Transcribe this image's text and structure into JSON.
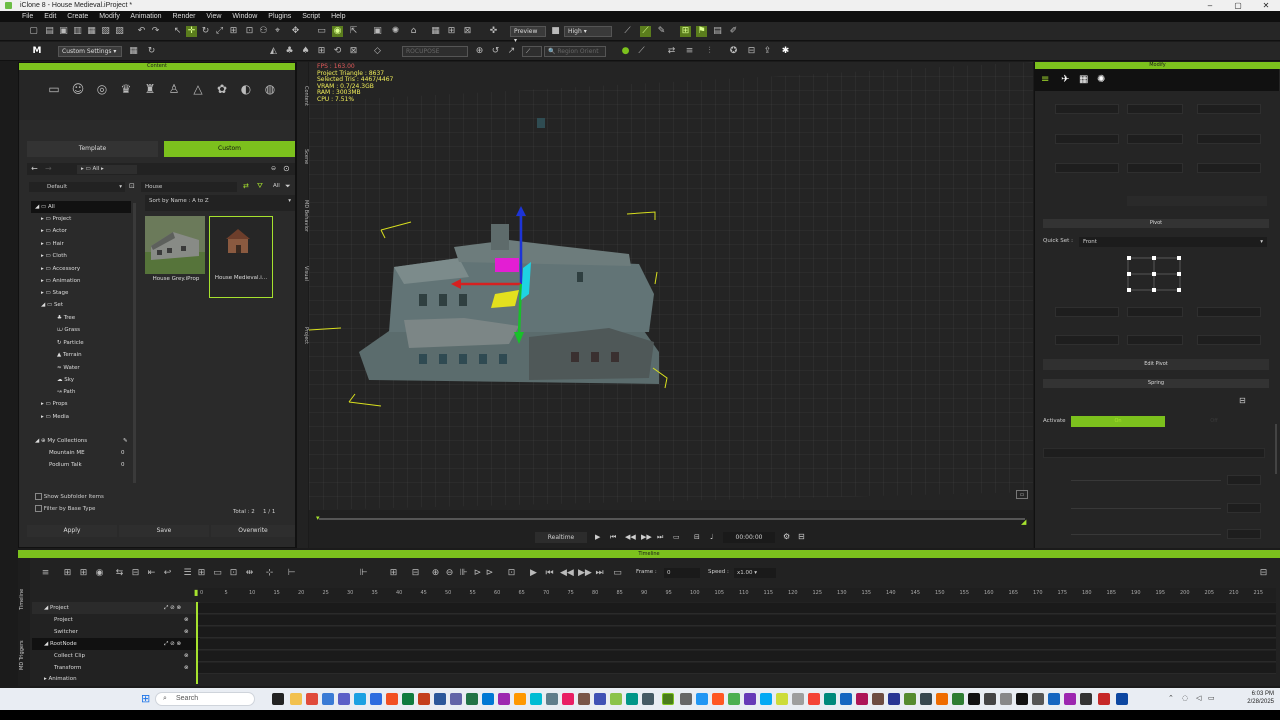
{
  "window": {
    "title": "iClone 8 - House Medieval.iProject *",
    "controls": [
      "–",
      "▢",
      "✕"
    ]
  },
  "menu": [
    "File",
    "Edit",
    "Create",
    "Modify",
    "Animation",
    "Render",
    "View",
    "Window",
    "Plugins",
    "Script",
    "Help"
  ],
  "toolbar": {
    "preview_label": "Preview",
    "quality_label": "High",
    "custom_settings": "Custom Settings",
    "rocupose": "ROCUPOSE",
    "region_orient": "Region Orient"
  },
  "content_panel": {
    "title": "Content",
    "tabs": [
      "Template",
      "Custom"
    ],
    "path": "All",
    "filter_default": "Default",
    "folder_name": "House",
    "filter_all": "All",
    "sort": "Sort by Name : A to Z",
    "tree": [
      {
        "label": "All",
        "level": 0
      },
      {
        "label": "Project",
        "level": 1
      },
      {
        "label": "Actor",
        "level": 1
      },
      {
        "label": "Hair",
        "level": 1
      },
      {
        "label": "Cloth",
        "level": 1
      },
      {
        "label": "Accessory",
        "level": 1
      },
      {
        "label": "Animation",
        "level": 1
      },
      {
        "label": "Stage",
        "level": 1
      },
      {
        "label": "Set",
        "level": 1
      },
      {
        "label": "Tree",
        "level": 2
      },
      {
        "label": "Grass",
        "level": 2
      },
      {
        "label": "Particle",
        "level": 2
      },
      {
        "label": "Terrain",
        "level": 2
      },
      {
        "label": "Water",
        "level": 2
      },
      {
        "label": "Sky",
        "level": 2
      },
      {
        "label": "Path",
        "level": 2
      },
      {
        "label": "Props",
        "level": 1
      },
      {
        "label": "Media",
        "level": 1
      }
    ],
    "collections": {
      "title": "My Collections",
      "items": [
        {
          "name": "Mountain ME",
          "count": "0"
        },
        {
          "name": "Podium Talk",
          "count": "0"
        }
      ]
    },
    "thumbnails": [
      {
        "label": "House Grey.iProp"
      },
      {
        "label": "House Medieval.i..."
      }
    ],
    "show_subfolder": "Show Subfolder Items",
    "filter_base": "Filter by Base Type",
    "total": "Total : 2",
    "page": "1 / 1",
    "buttons": [
      "Apply",
      "Save",
      "Overwrite"
    ]
  },
  "side_tabs": [
    "Content",
    "Scene",
    "MD Behavior",
    "Visual",
    "Project"
  ],
  "viewport": {
    "stats": [
      "FPS : 163.00",
      "Project Triangle : 8637",
      "Selected Tris : 4467/4467",
      "VRAM : 0.7/24.3GB",
      "RAM : 3003MB",
      "CPU : 7.51%"
    ],
    "play_mode": "Realtime",
    "time": "00:00:00"
  },
  "modify_panel": {
    "title": "Modify",
    "pivot_section": "Pivot",
    "quick_set_label": "Quick Set :",
    "quick_set_value": "Front",
    "edit_pivot": "Edit Pivot",
    "spring_section": "Spring",
    "activate_label": "Activate",
    "activate_on": "On",
    "activate_off": "Off"
  },
  "timeline": {
    "title": "Timeline",
    "frame_label": "Frame :",
    "frame_value": "0",
    "speed_label": "Speed :",
    "speed_value": "x1.00",
    "ruler": [
      "0",
      "5",
      "10",
      "15",
      "20",
      "25",
      "30",
      "35",
      "40",
      "45",
      "50",
      "55",
      "60",
      "65",
      "70",
      "75",
      "80",
      "85",
      "90",
      "95",
      "100",
      "105",
      "110",
      "115",
      "120",
      "125",
      "130",
      "135",
      "140",
      "145",
      "150",
      "155",
      "160",
      "165",
      "170",
      "175",
      "180",
      "185",
      "190",
      "195",
      "200",
      "205",
      "210",
      "215"
    ],
    "tracks": [
      {
        "label": "Project",
        "level": 0
      },
      {
        "label": "Project",
        "level": 1
      },
      {
        "label": "Switcher",
        "level": 1
      },
      {
        "label": "RootNode",
        "level": 0
      },
      {
        "label": "Collect Clip",
        "level": 1
      },
      {
        "label": "Transform",
        "level": 1
      },
      {
        "label": "Animation",
        "level": 0
      }
    ],
    "vtabs": [
      "Timeline",
      "MD Triggers"
    ]
  },
  "taskbar": {
    "search_placeholder": "Search",
    "time": "6:03 PM",
    "date": "2/28/2025"
  },
  "colors": {
    "accent": "#7cc11d",
    "panel": "#2a2a2a",
    "stats_text": "#f2ef5a"
  }
}
